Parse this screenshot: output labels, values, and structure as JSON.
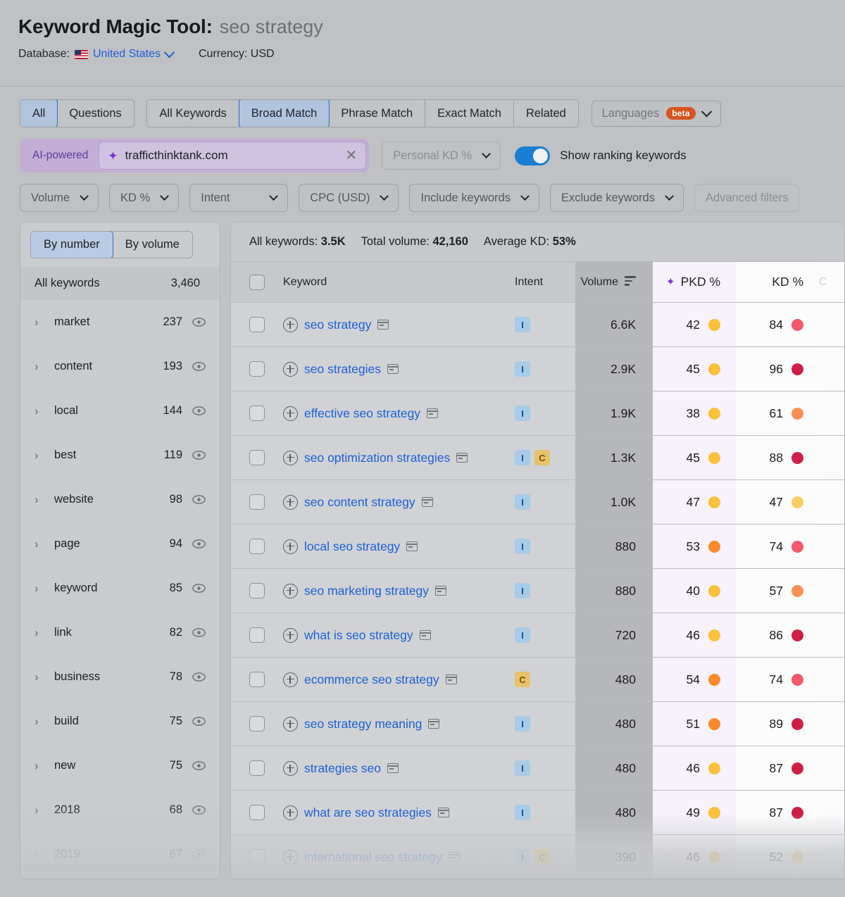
{
  "header": {
    "title_main": "Keyword Magic Tool:",
    "title_query": "seo strategy",
    "database_label": "Database:",
    "database_value": "United States",
    "currency_label": "Currency: USD",
    "flag_icon": "us-flag-icon"
  },
  "tabs": {
    "group1": [
      {
        "label": "All",
        "active": true
      },
      {
        "label": "Questions",
        "active": false
      }
    ],
    "group2": [
      {
        "label": "All Keywords",
        "active": false
      },
      {
        "label": "Broad Match",
        "active": true
      },
      {
        "label": "Phrase Match",
        "active": false
      },
      {
        "label": "Exact Match",
        "active": false
      },
      {
        "label": "Related",
        "active": false
      }
    ],
    "languages": {
      "label": "Languages",
      "badge": "beta"
    }
  },
  "ai_search": {
    "ai_label": "AI-powered",
    "value": "trafficthinktank.com",
    "clear_icon": "close-icon",
    "sparkle_icon": "sparkle-icon",
    "personal_kd_label": "Personal KD %",
    "toggle_label": "Show ranking keywords",
    "toggle_on": true
  },
  "filters": [
    {
      "label": "Volume"
    },
    {
      "label": "KD %"
    },
    {
      "label": "Intent"
    },
    {
      "label": "CPC (USD)"
    },
    {
      "label": "Include keywords"
    },
    {
      "label": "Exclude keywords"
    },
    {
      "label": "Advanced filters"
    }
  ],
  "sidebar": {
    "toggle": [
      {
        "label": "By number",
        "active": true
      },
      {
        "label": "By volume",
        "active": false
      }
    ],
    "all_keywords_label": "All keywords",
    "all_keywords_count": "3,460",
    "items": [
      {
        "label": "market",
        "count": "237"
      },
      {
        "label": "content",
        "count": "193"
      },
      {
        "label": "local",
        "count": "144"
      },
      {
        "label": "best",
        "count": "119"
      },
      {
        "label": "website",
        "count": "98"
      },
      {
        "label": "page",
        "count": "94"
      },
      {
        "label": "keyword",
        "count": "85"
      },
      {
        "label": "link",
        "count": "82"
      },
      {
        "label": "business",
        "count": "78"
      },
      {
        "label": "build",
        "count": "75"
      },
      {
        "label": "new",
        "count": "75"
      },
      {
        "label": "2018",
        "count": "68"
      },
      {
        "label": "2019",
        "count": "67"
      }
    ]
  },
  "table": {
    "summary": {
      "all_keywords": "All keywords: ",
      "all_keywords_value": "3.5K",
      "total_volume": "Total volume: ",
      "total_volume_value": "42,160",
      "average_kd": "Average KD: ",
      "average_kd_value": "53%"
    },
    "columns": {
      "keyword": "Keyword",
      "intent": "Intent",
      "volume": "Volume",
      "pkd": "PKD %",
      "kd": "KD %",
      "cut": "C"
    },
    "rows": [
      {
        "keyword": "seo strategy",
        "intent": [
          "I"
        ],
        "volume": "6.6K",
        "pkd": "42",
        "pkd_color": "#fcc03a",
        "kd": "84",
        "kd_color": "#f4596a"
      },
      {
        "keyword": "seo strategies",
        "intent": [
          "I"
        ],
        "volume": "2.9K",
        "pkd": "45",
        "pkd_color": "#fcc03a",
        "kd": "96",
        "kd_color": "#cf1e46"
      },
      {
        "keyword": "effective seo strategy",
        "intent": [
          "I"
        ],
        "volume": "1.9K",
        "pkd": "38",
        "pkd_color": "#fcc03a",
        "kd": "61",
        "kd_color": "#fa9254"
      },
      {
        "keyword": "seo optimization strategies",
        "intent": [
          "I",
          "C"
        ],
        "volume": "1.3K",
        "pkd": "45",
        "pkd_color": "#fcc03a",
        "kd": "88",
        "kd_color": "#cf1e46"
      },
      {
        "keyword": "seo content strategy",
        "intent": [
          "I"
        ],
        "volume": "1.0K",
        "pkd": "47",
        "pkd_color": "#fcc03a",
        "kd": "47",
        "kd_color": "#fcce5c"
      },
      {
        "keyword": "local seo strategy",
        "intent": [
          "I"
        ],
        "volume": "880",
        "pkd": "53",
        "pkd_color": "#fa8b2a",
        "kd": "74",
        "kd_color": "#f4596a"
      },
      {
        "keyword": "seo marketing strategy",
        "intent": [
          "I"
        ],
        "volume": "880",
        "pkd": "40",
        "pkd_color": "#fcc03a",
        "kd": "57",
        "kd_color": "#fa9254"
      },
      {
        "keyword": "what is seo strategy",
        "intent": [
          "I"
        ],
        "volume": "720",
        "pkd": "46",
        "pkd_color": "#fcc03a",
        "kd": "86",
        "kd_color": "#cf1e46"
      },
      {
        "keyword": "ecommerce seo strategy",
        "intent": [
          "C"
        ],
        "volume": "480",
        "pkd": "54",
        "pkd_color": "#fa8b2a",
        "kd": "74",
        "kd_color": "#f4596a"
      },
      {
        "keyword": "seo strategy meaning",
        "intent": [
          "I"
        ],
        "volume": "480",
        "pkd": "51",
        "pkd_color": "#fa8b2a",
        "kd": "89",
        "kd_color": "#cf1e46"
      },
      {
        "keyword": "strategies seo",
        "intent": [
          "I"
        ],
        "volume": "480",
        "pkd": "46",
        "pkd_color": "#fcc03a",
        "kd": "87",
        "kd_color": "#cf1e46"
      },
      {
        "keyword": "what are seo strategies",
        "intent": [
          "I"
        ],
        "volume": "480",
        "pkd": "49",
        "pkd_color": "#fcc03a",
        "kd": "87",
        "kd_color": "#cf1e46"
      },
      {
        "keyword": "international seo strategy",
        "intent": [
          "I",
          "C"
        ],
        "volume": "390",
        "pkd": "46",
        "pkd_color": "#fcc03a",
        "kd": "52",
        "kd_color": "#fcce5c"
      }
    ]
  },
  "colors": {
    "link": "#1a61d8",
    "accent_purple": "#7a33d1",
    "toggle_on": "#1a7fd4",
    "beta_badge": "#d9541e"
  }
}
